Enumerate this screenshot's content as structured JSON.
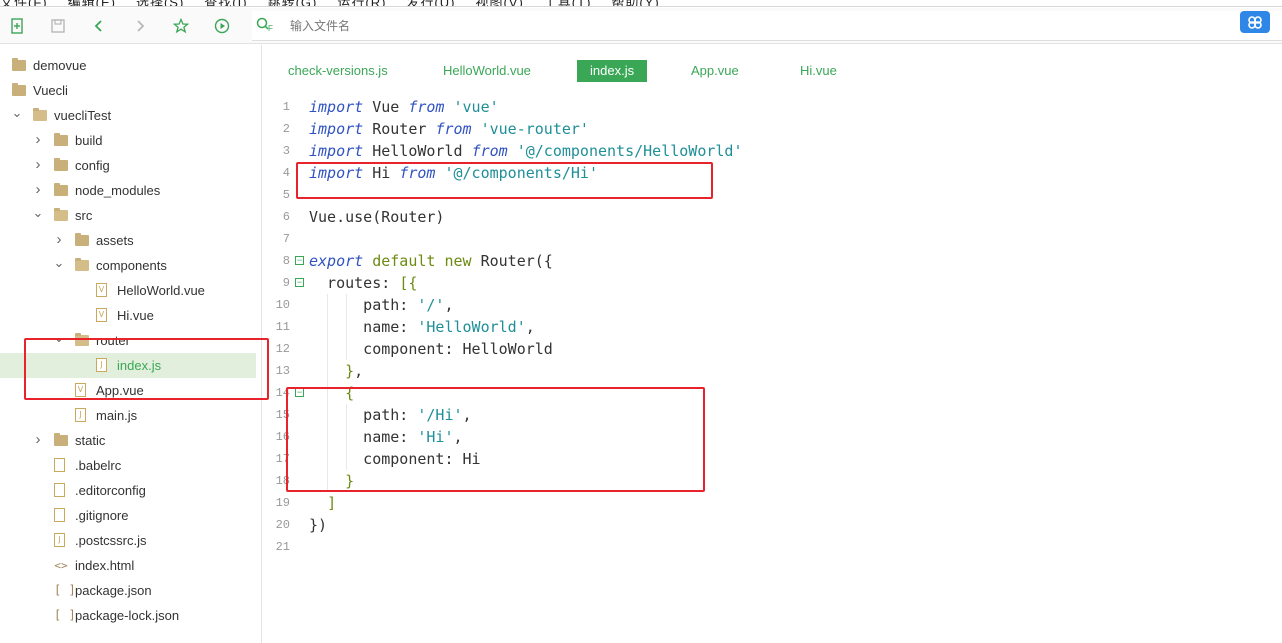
{
  "menu": [
    "文件(F)",
    "编辑(E)",
    "选择(S)",
    "查找(I)",
    "跳转(G)",
    "运行(R)",
    "发行(U)",
    "视图(V)",
    "工具(T)",
    "帮助(Y)"
  ],
  "toolbar": {
    "search_placeholder": "输入文件名",
    "search_icon_label": "F"
  },
  "sidebar": {
    "items": [
      {
        "label": "demovue"
      },
      {
        "label": "Vuecli"
      },
      {
        "label": "vuecliTest"
      },
      {
        "label": "build"
      },
      {
        "label": "config"
      },
      {
        "label": "node_modules"
      },
      {
        "label": "src"
      },
      {
        "label": "assets"
      },
      {
        "label": "components"
      },
      {
        "label": "HelloWorld.vue"
      },
      {
        "label": "Hi.vue"
      },
      {
        "label": "router"
      },
      {
        "label": "index.js"
      },
      {
        "label": "App.vue"
      },
      {
        "label": "main.js"
      },
      {
        "label": "static"
      },
      {
        "label": ".babelrc"
      },
      {
        "label": ".editorconfig"
      },
      {
        "label": ".gitignore"
      },
      {
        "label": ".postcssrc.js"
      },
      {
        "label": "index.html"
      },
      {
        "label": "package.json"
      },
      {
        "label": "package-lock.json"
      }
    ]
  },
  "tabs": [
    "check-versions.js",
    "HelloWorld.vue",
    "index.js",
    "App.vue",
    "Hi.vue"
  ],
  "active_tab": "index.js",
  "editor": {
    "line_numbers": [
      "1",
      "2",
      "3",
      "4",
      "5",
      "6",
      "7",
      "8",
      "9",
      "10",
      "11",
      "12",
      "13",
      "14",
      "15",
      "16",
      "17",
      "18",
      "19",
      "20",
      "21"
    ]
  },
  "colors": {
    "accent": "#3aa757",
    "highlight_box": "#e8232b",
    "keyword": "#3153c2",
    "string": "#1f8f98"
  }
}
